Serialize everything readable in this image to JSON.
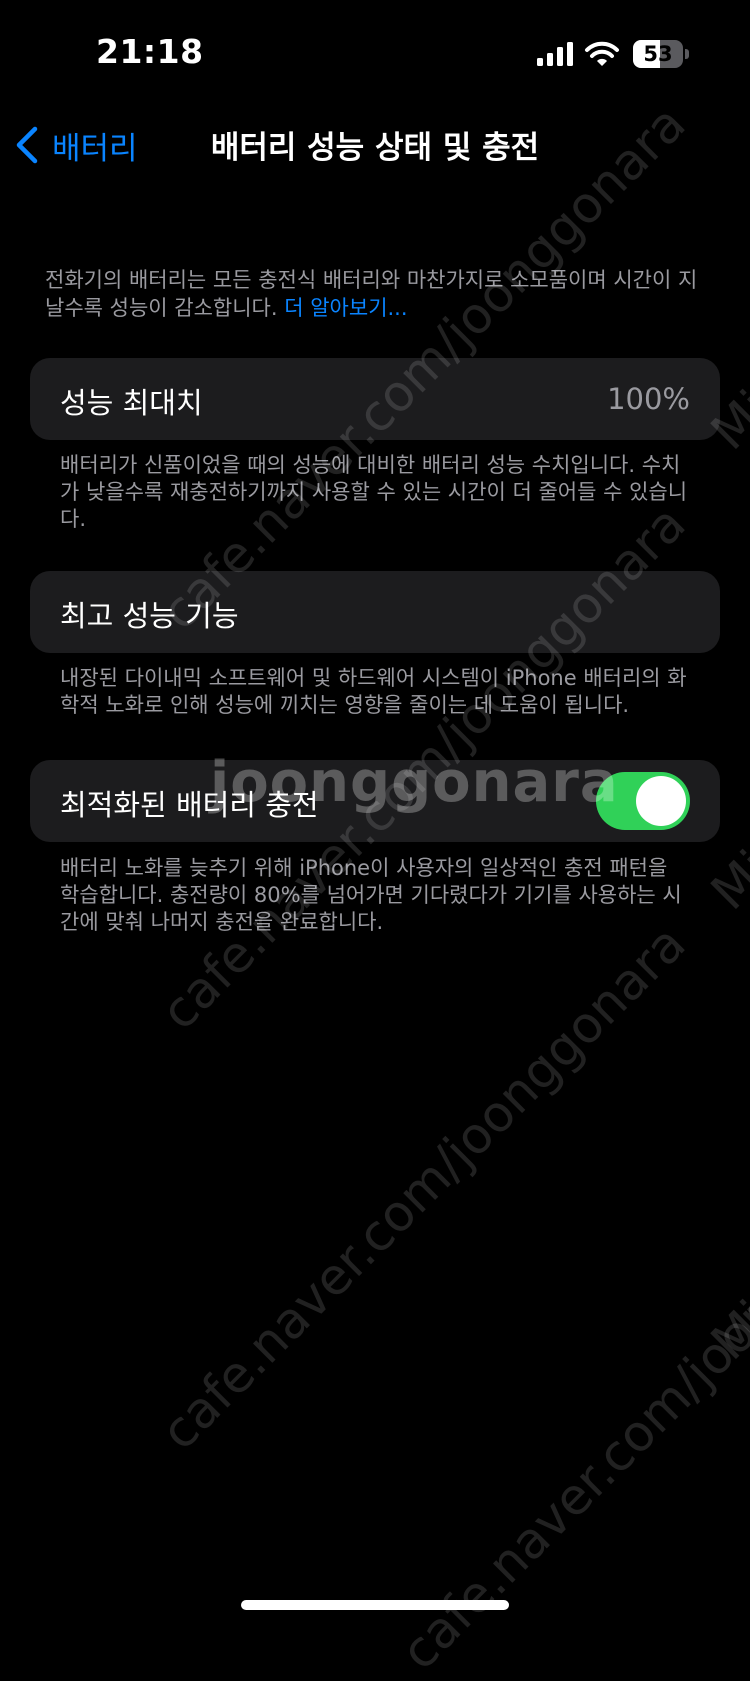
{
  "status_bar": {
    "time": "21:18",
    "battery_level": "53",
    "battery_fraction": 0.53
  },
  "nav": {
    "back_label": "배터리",
    "title": "배터리 성능 상태 및 충전"
  },
  "intro": {
    "text": "전화기의 배터리는 모든 충전식 배터리와 마찬가지로 소모품이며 시간이 지날수록 성능이 감소합니다.",
    "link": "더 알아보기..."
  },
  "max_capacity": {
    "label": "성능 최대치",
    "value": "100%",
    "description": "배터리가 신품이었을 때의 성능에 대비한 배터리 성능 수치입니다. 수치가 낮을수록 재충전하기까지 사용할 수 있는 시간이 더 줄어들 수 있습니다."
  },
  "peak_performance": {
    "label": "최고 성능 기능",
    "description": "내장된 다이내믹 소프트웨어 및 하드웨어 시스템이 iPhone 배터리의 화학적 노화로 인해 성능에 끼치는 영향을 줄이는 데 도움이 됩니다."
  },
  "optimized_charging": {
    "label": "최적화된 배터리 충전",
    "enabled": true,
    "description": "배터리 노화를 늦추기 위해 iPhone이 사용자의 일상적인 충전 패턴을 학습합니다. 충전량이 80%를 넘어가면 기다렸다가 기기를 사용하는 시간에 맞춰 나머지 충전을 완료합니다."
  },
  "watermarks": {
    "url": "cafe.naver.com/joonggonara",
    "brand": "joonggonara",
    "side": "Mir"
  },
  "colors": {
    "accent_blue": "#0a84ff",
    "toggle_green": "#30d158",
    "card_bg": "#1c1c1e",
    "secondary_text": "#9a9aa0"
  },
  "icons": {
    "signal": "signal-bars-icon",
    "wifi": "wifi-icon",
    "battery": "battery-icon",
    "back": "chevron-left-icon"
  }
}
